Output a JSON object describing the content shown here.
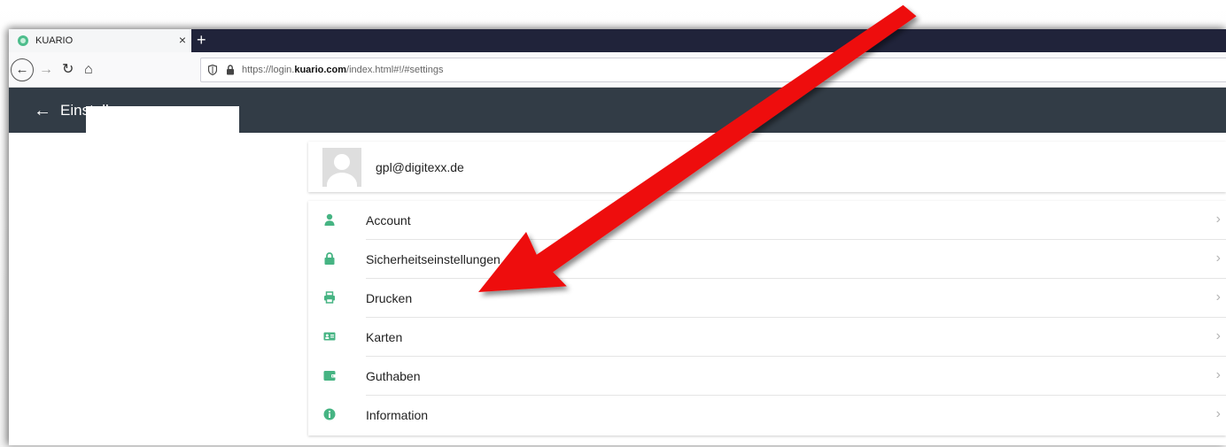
{
  "browser": {
    "tab_title": "KUARIO",
    "tab_close": "×",
    "new_tab": "+",
    "url_prefix": "https://login.",
    "url_domain": "kuario.com",
    "url_suffix": "/index.html#!/#settings"
  },
  "header": {
    "back_symbol": "←",
    "title": "Einstellungen"
  },
  "profile": {
    "email": "gpl@digitexx.de"
  },
  "menu": {
    "items": [
      {
        "label": "Account",
        "icon": "user-icon"
      },
      {
        "label": "Sicherheitseinstellungen",
        "icon": "lock-icon"
      },
      {
        "label": "Drucken",
        "icon": "printer-icon"
      },
      {
        "label": "Karten",
        "icon": "id-card-icon"
      },
      {
        "label": "Guthaben",
        "icon": "wallet-icon"
      },
      {
        "label": "Information",
        "icon": "info-icon"
      }
    ],
    "chevron": "›"
  },
  "colors": {
    "accent": "#46b483",
    "header_bg": "#323c46",
    "arrow": "#ee1111"
  }
}
